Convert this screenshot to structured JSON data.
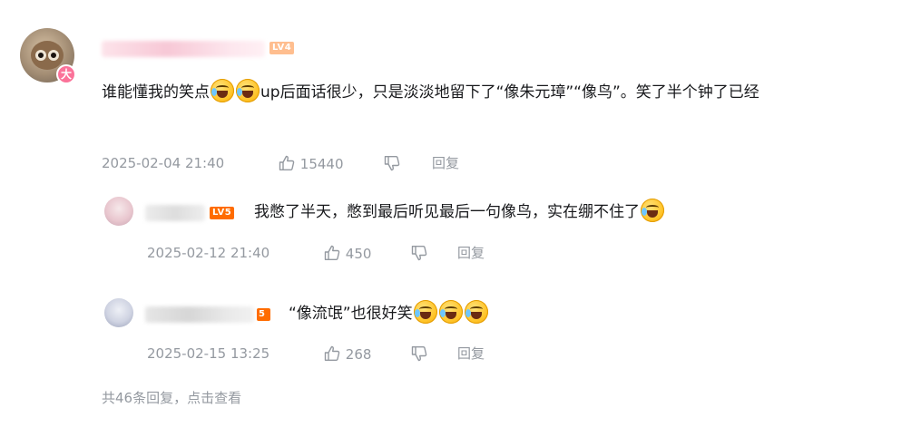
{
  "main_comment": {
    "badge": "大",
    "level": "LV4",
    "text_before": "谁能懂我的笑点",
    "text_after": "up后面话很少，只是淡淡地留下了“像朱元璋”“像鸟”。笑了半个钟了已经",
    "time": "2025-02-04 21:40",
    "likes": "15440",
    "reply_label": "回复"
  },
  "replies": [
    {
      "level": "LV5",
      "text": "我憋了半天，憋到最后听见最后一句像鸟，实在绷不住了",
      "time": "2025-02-12 21:40",
      "likes": "450",
      "reply_label": "回复"
    },
    {
      "level": "5",
      "text": "“像流氓”也很好笑",
      "time": "2025-02-15 13:25",
      "likes": "268",
      "reply_label": "回复"
    }
  ],
  "more_replies": "共46条回复，点击查看",
  "icons": {
    "like": "thumbs-up-icon",
    "dislike": "thumbs-down-icon",
    "emoji": "laughing-crying-emoji-icon"
  },
  "colors": {
    "text": "#18191c",
    "meta": "#9499a0",
    "badge_pink": "#fb7299",
    "level_orange": "#ff6c00"
  }
}
